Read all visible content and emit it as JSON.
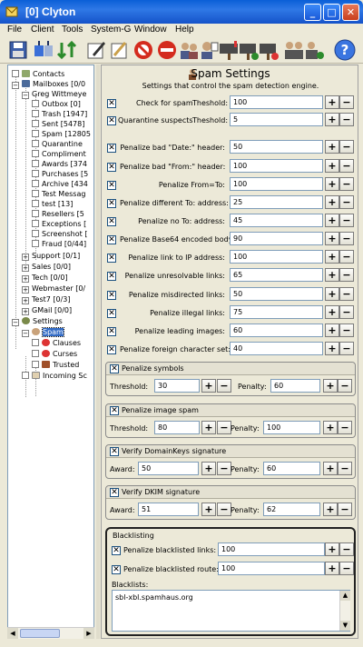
{
  "window": {
    "title": "[0] Clyton",
    "min": "_",
    "max": "□",
    "close": "✕"
  },
  "menu": [
    "File",
    "Client",
    "Tools",
    "System-G",
    "Window",
    "Help"
  ],
  "toolbar_icons": [
    "save-icon",
    "send-receive-icon",
    "switch-icon",
    "compose-icon",
    "stop-spam-icon",
    "accounts-icon",
    "contacts-icon",
    "mailbox-icon",
    "mailbox-add-icon",
    "mailbox-remove-icon",
    "users-icon",
    "user-add-icon",
    "user-remove-icon",
    "help-icon"
  ],
  "tree": {
    "contacts": "Contacts",
    "mailboxes": "Mailboxes [0/0",
    "account": "Greg Wittmeye",
    "folders": [
      "Outbox [0]",
      "Trash [1947]",
      "Sent [5478]",
      "Spam [12805",
      "Quarantine",
      "Compliment",
      "Awards [374",
      "Purchases [5",
      "Archive [434",
      "Test Messag",
      "test [13]",
      "Resellers [5",
      "Exceptions [",
      "Screenshot [",
      "Fraud [0/44]"
    ],
    "groups": [
      "Support [0/1]",
      "Sales [0/0]",
      "Tech [0/0]",
      "Webmaster [0/",
      "Test7 [0/3]",
      "GMail [0/0]"
    ],
    "settings": "Settings",
    "spam": "Spam",
    "spam_children": [
      "Clauses",
      "Curses",
      "Trusted"
    ],
    "incoming": "Incoming Sc"
  },
  "panel": {
    "title": "Spam Settings",
    "subtitle": "Settings that control the spam detection engine.",
    "check_spam": {
      "label": "Check for spam",
      "threshold_label": "Theshold:",
      "value": "100"
    },
    "quarantine": {
      "label": "Quarantine suspects",
      "threshold_label": "Theshold:",
      "value": "5"
    },
    "penalties": [
      {
        "label": "Penalize bad \"Date:\" header:",
        "value": "50"
      },
      {
        "label": "Penalize bad \"From:\" header:",
        "value": "100"
      },
      {
        "label": "Penalize From=To:",
        "value": "100"
      },
      {
        "label": "Penalize different To: address:",
        "value": "25"
      },
      {
        "label": "Penalize no To: address:",
        "value": "45"
      },
      {
        "label": "Penalize Base64 encoded body:",
        "value": "90"
      },
      {
        "label": "Penalize link to IP address:",
        "value": "100"
      },
      {
        "label": "Penalize unresolvable links:",
        "value": "65"
      },
      {
        "label": "Penalize misdirected links:",
        "value": "50"
      },
      {
        "label": "Penalize illegal links:",
        "value": "75"
      },
      {
        "label": "Penalize leading images:",
        "value": "60"
      },
      {
        "label": "Penalize foreign character set:",
        "value": "40"
      }
    ],
    "symbols": {
      "title": "Penalize symbols",
      "threshold_label": "Threshold:",
      "threshold": "30",
      "penalty_label": "Penalty:",
      "penalty": "60"
    },
    "image_spam": {
      "title": "Penalize image spam",
      "threshold_label": "Threshold:",
      "threshold": "80",
      "penalty_label": "Penalty:",
      "penalty": "100"
    },
    "domainkeys": {
      "title": "Verify DomainKeys signature",
      "award_label": "Award:",
      "award": "50",
      "penalty_label": "Penalty:",
      "penalty": "60"
    },
    "dkim": {
      "title": "Verify DKIM signature",
      "award_label": "Award:",
      "award": "51",
      "penalty_label": "Penalty:",
      "penalty": "62"
    },
    "blacklisting": {
      "title": "Blacklisting",
      "links_label": "Penalize blacklisted links:",
      "links": "100",
      "route_label": "Penalize blacklisted route:",
      "route": "100",
      "lists_label": "Blacklists:",
      "lists": "sbl-xbl.spamhaus.org"
    },
    "plus": "+",
    "minus": "−",
    "check": "✕"
  }
}
